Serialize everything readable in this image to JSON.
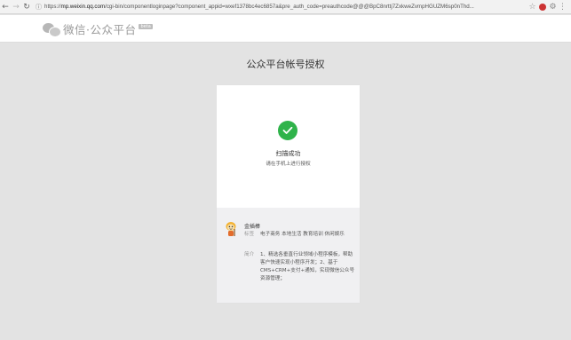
{
  "browser": {
    "url_host": "mp.weixin.qq.com",
    "url_prefix": "https://",
    "url_rest": "/cgi-bin/componentloginpage?component_appid=wxef1378bc4ec6857a&pre_auth_code=preauthcode@@@BpC8nrttj7ZxkweZvmpHGUZM6sp0nThd..."
  },
  "header": {
    "logo_text": "微信·公众平台",
    "beta_label": "beta"
  },
  "page": {
    "title": "公众平台帐号授权",
    "status": "扫描成功",
    "hint": "请在手机上进行授权"
  },
  "app": {
    "name": "金插棒",
    "tags_label": "标签",
    "tags_value": "电子商务 本地生活 教育培训 休闲娱乐",
    "intro_label": "简介",
    "intro_value": "1、精选各垂直行业领域小程序模板，帮助客户快速实现小程序开发；2、基于CMS+CRM+支付+通知，实现微信公众号资源管理；"
  },
  "colors": {
    "success": "#2fb34a",
    "page_bg": "#e3e3e3"
  }
}
